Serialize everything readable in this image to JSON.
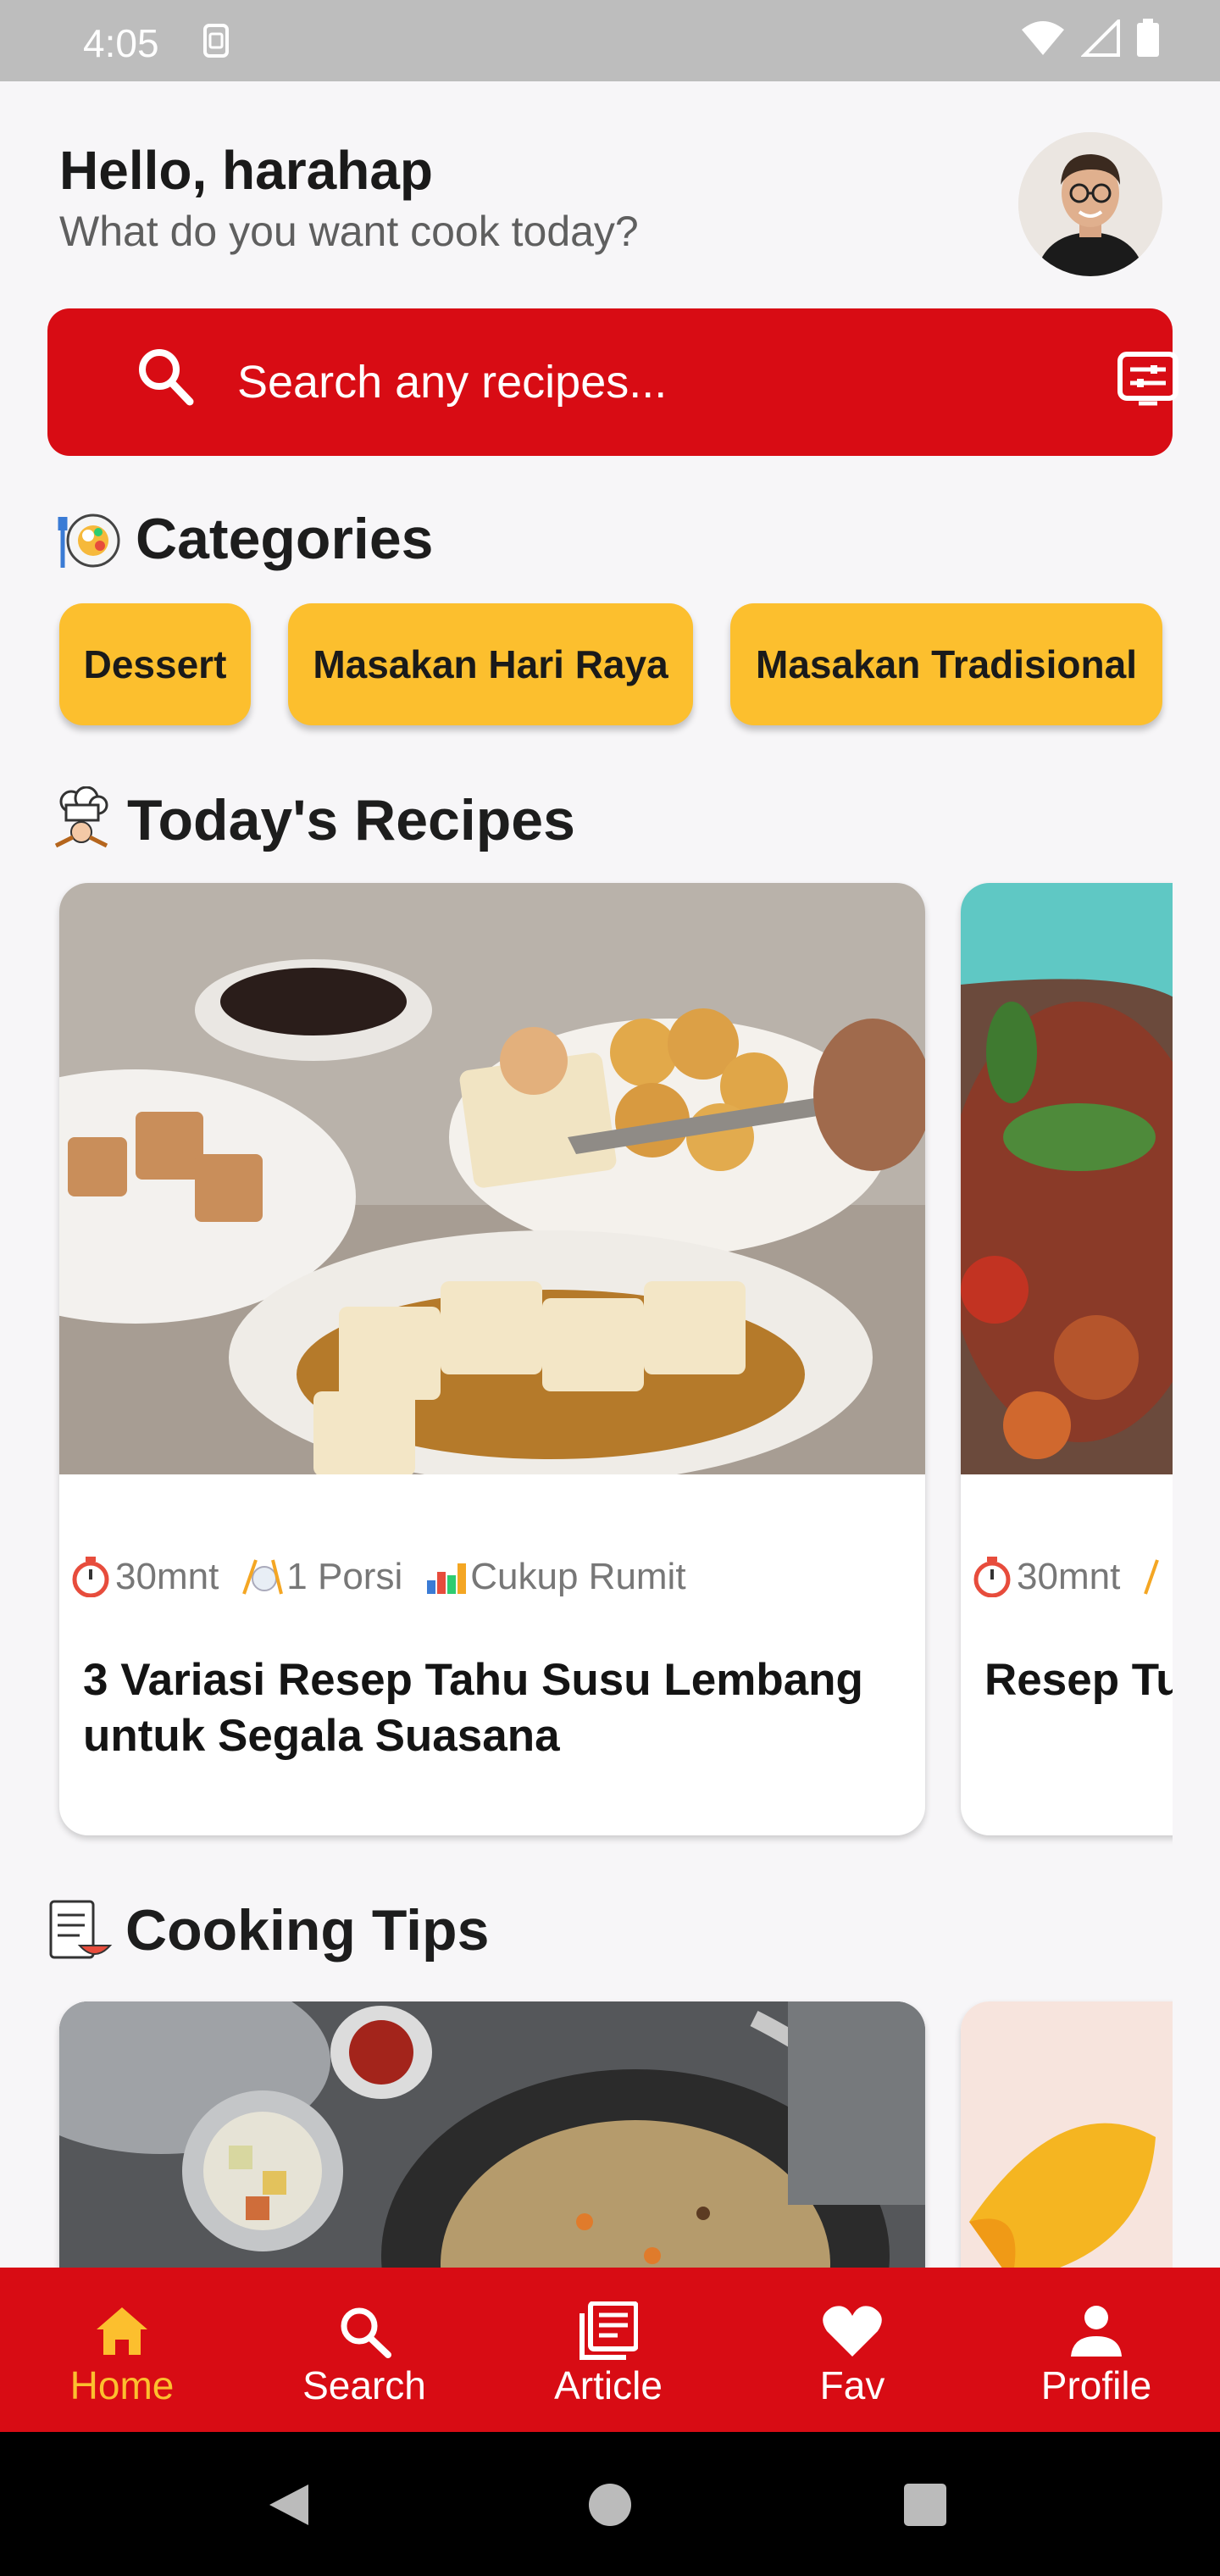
{
  "status_bar": {
    "time": "4:05"
  },
  "header": {
    "greeting": "Hello, harahap",
    "subtitle": "What do you want cook today?"
  },
  "search": {
    "placeholder": "Search any recipes..."
  },
  "categories": {
    "title": "Categories",
    "items": [
      {
        "label": "Dessert"
      },
      {
        "label": "Masakan Hari Raya"
      },
      {
        "label": "Masakan Tradisional"
      }
    ]
  },
  "todays_recipes": {
    "title": "Today's Recipes",
    "cards": [
      {
        "time": "30mnt",
        "portion": "1 Porsi",
        "difficulty": "Cukup Rumit",
        "title": "3 Variasi Resep Tahu Susu Lembang untuk Segala Suasana"
      },
      {
        "time": "30mnt",
        "title": "Resep Tu... Simpel d..."
      }
    ]
  },
  "cooking_tips": {
    "title": "Cooking Tips"
  },
  "bottom_nav": {
    "items": [
      {
        "label": "Home"
      },
      {
        "label": "Search"
      },
      {
        "label": "Article"
      },
      {
        "label": "Fav"
      },
      {
        "label": "Profile"
      }
    ],
    "active_index": 0
  },
  "colors": {
    "primary_red": "#d80c14",
    "accent_yellow": "#fcbf2e",
    "background": "#f7f6f8"
  }
}
